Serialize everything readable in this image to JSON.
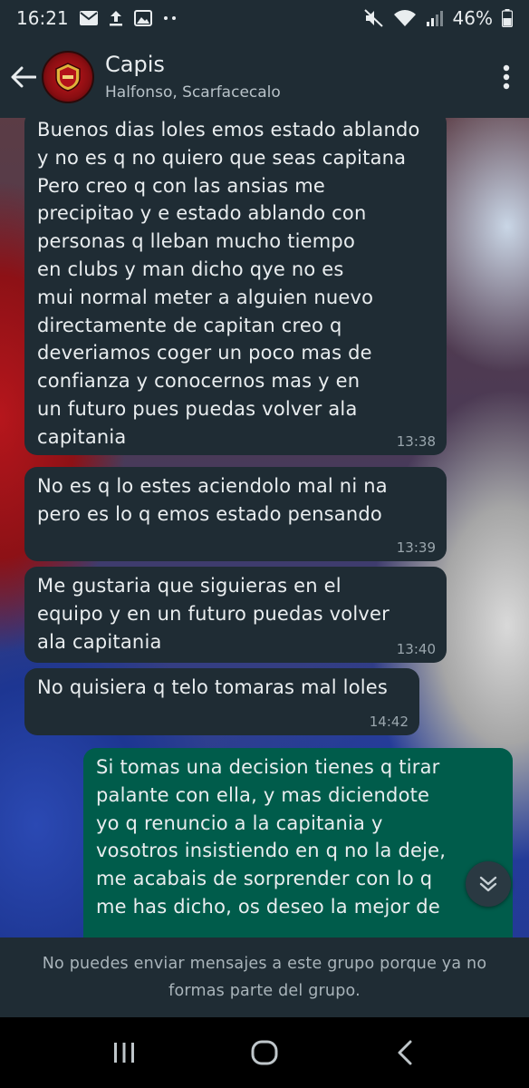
{
  "status_bar": {
    "time": "16:21",
    "battery": "46%",
    "left_icons": [
      "mail-icon",
      "upload-icon",
      "image-icon",
      "more-dots-icon"
    ],
    "right_icons": [
      "mute-icon",
      "wifi-icon",
      "signal-icon",
      "battery-icon"
    ]
  },
  "header": {
    "title": "Capis",
    "subtitle": "Halfonso, Scarfacecalo"
  },
  "messages": [
    {
      "direction": "in",
      "text": "Buenos dias loles emos estado ablando\ny no es q no quiero que seas capitana\nPero creo q con las ansias me\nprecipitao y e estado ablando con\npersonas q lleban mucho tiempo\nen clubs y man dicho qye no es\nmui normal meter a alguien nuevo\ndirectamente de capitan creo q\ndeveriamos coger un poco mas de\nconfianza y conocernos mas y en\nun futuro pues puedas volver ala\ncapitania",
      "time": "13:38"
    },
    {
      "direction": "in",
      "text": "No es q lo estes aciendolo mal ni na\npero es lo q emos estado pensando",
      "time": "13:39"
    },
    {
      "direction": "in",
      "text": "Me gustaria que siguieras en el\nequipo y en un futuro puedas volver\nala capitania",
      "time": "13:40"
    },
    {
      "direction": "in",
      "text": "No quisiera q telo tomaras mal loles",
      "time": "14:42"
    },
    {
      "direction": "out",
      "text": "Si tomas una decision tienes q tirar\npalante con ella, y mas diciendote\nyo q renuncio a la capitania y\nvosotros insistiendo en q no la deje,\nme acabais de sorprender con lo q\nme has dicho, os deseo la mejor de",
      "time": ""
    }
  ],
  "footer": {
    "notice": "No puedes enviar mensajes a este grupo porque ya no formas parte del grupo."
  },
  "colors": {
    "header_bg": "#1f2c34",
    "incoming_bubble": "#1f2c34",
    "outgoing_bubble": "#005c4b"
  }
}
